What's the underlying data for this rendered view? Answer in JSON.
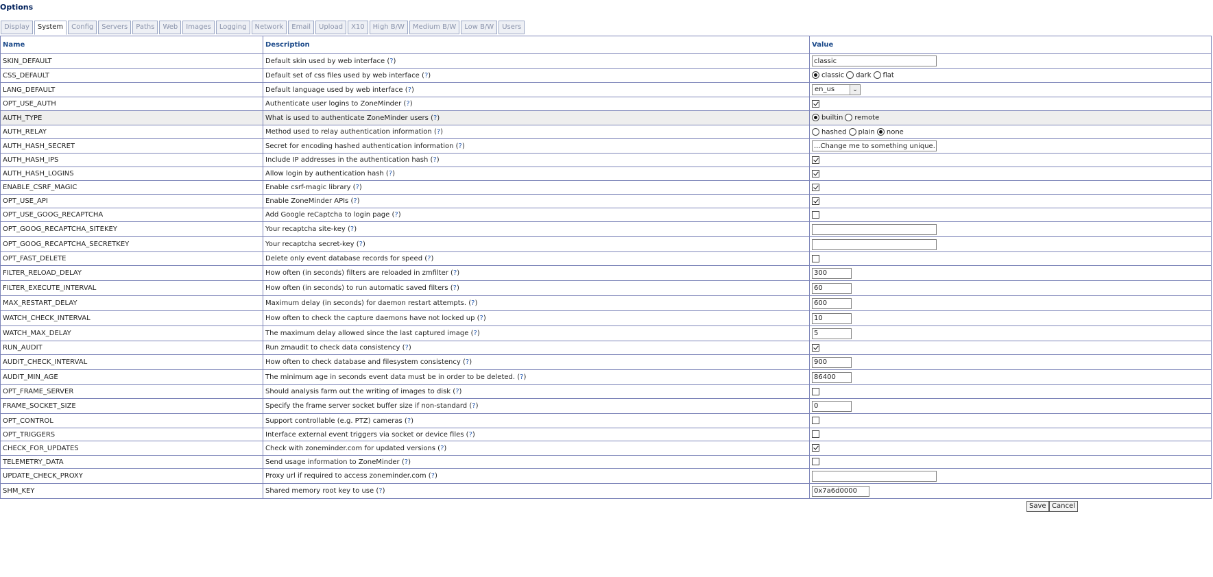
{
  "title": "Options",
  "tabs": [
    "Display",
    "System",
    "Config",
    "Servers",
    "Paths",
    "Web",
    "Images",
    "Logging",
    "Network",
    "Email",
    "Upload",
    "X10",
    "High B/W",
    "Medium B/W",
    "Low B/W",
    "Users"
  ],
  "active_tab": "System",
  "columns": {
    "name": "Name",
    "description": "Description",
    "value": "Value"
  },
  "help_link": "?",
  "rows": [
    {
      "name": "SKIN_DEFAULT",
      "desc": "Default skin used by web interface",
      "type": "text",
      "value": "classic",
      "width": "long"
    },
    {
      "name": "CSS_DEFAULT",
      "desc": "Default set of css files used by web interface",
      "type": "radio",
      "options": [
        "classic",
        "dark",
        "flat"
      ],
      "selected": "classic"
    },
    {
      "name": "LANG_DEFAULT",
      "desc": "Default language used by web interface",
      "type": "select",
      "value": "en_us"
    },
    {
      "name": "OPT_USE_AUTH",
      "desc": "Authenticate user logins to ZoneMinder",
      "type": "checkbox",
      "checked": true
    },
    {
      "name": "AUTH_TYPE",
      "desc": "What is used to authenticate ZoneMinder users",
      "type": "radio",
      "options": [
        "builtin",
        "remote"
      ],
      "selected": "builtin",
      "highlight": true
    },
    {
      "name": "AUTH_RELAY",
      "desc": "Method used to relay authentication information",
      "type": "radio",
      "options": [
        "hashed",
        "plain",
        "none"
      ],
      "selected": "none"
    },
    {
      "name": "AUTH_HASH_SECRET",
      "desc": "Secret for encoding hashed authentication information",
      "type": "text",
      "value": "...Change me to something unique...",
      "width": "long"
    },
    {
      "name": "AUTH_HASH_IPS",
      "desc": "Include IP addresses in the authentication hash",
      "type": "checkbox",
      "checked": true
    },
    {
      "name": "AUTH_HASH_LOGINS",
      "desc": "Allow login by authentication hash",
      "type": "checkbox",
      "checked": true
    },
    {
      "name": "ENABLE_CSRF_MAGIC",
      "desc": "Enable csrf-magic library",
      "type": "checkbox",
      "checked": true
    },
    {
      "name": "OPT_USE_API",
      "desc": "Enable ZoneMinder APIs",
      "type": "checkbox",
      "checked": true
    },
    {
      "name": "OPT_USE_GOOG_RECAPTCHA",
      "desc": "Add Google reCaptcha to login page",
      "type": "checkbox",
      "checked": false
    },
    {
      "name": "OPT_GOOG_RECAPTCHA_SITEKEY",
      "desc": "Your recaptcha site-key",
      "type": "text",
      "value": "",
      "width": "long"
    },
    {
      "name": "OPT_GOOG_RECAPTCHA_SECRETKEY",
      "desc": "Your recaptcha secret-key",
      "type": "text",
      "value": "",
      "width": "long"
    },
    {
      "name": "OPT_FAST_DELETE",
      "desc": "Delete only event database records for speed",
      "type": "checkbox",
      "checked": false
    },
    {
      "name": "FILTER_RELOAD_DELAY",
      "desc": "How often (in seconds) filters are reloaded in zmfilter",
      "type": "text",
      "value": "300",
      "width": "short"
    },
    {
      "name": "FILTER_EXECUTE_INTERVAL",
      "desc": "How often (in seconds) to run automatic saved filters",
      "type": "text",
      "value": "60",
      "width": "short"
    },
    {
      "name": "MAX_RESTART_DELAY",
      "desc": "Maximum delay (in seconds) for daemon restart attempts.",
      "type": "text",
      "value": "600",
      "width": "short"
    },
    {
      "name": "WATCH_CHECK_INTERVAL",
      "desc": "How often to check the capture daemons have not locked up",
      "type": "text",
      "value": "10",
      "width": "short"
    },
    {
      "name": "WATCH_MAX_DELAY",
      "desc": "The maximum delay allowed since the last captured image",
      "type": "text",
      "value": "5",
      "width": "short"
    },
    {
      "name": "RUN_AUDIT",
      "desc": "Run zmaudit to check data consistency",
      "type": "checkbox",
      "checked": true
    },
    {
      "name": "AUDIT_CHECK_INTERVAL",
      "desc": "How often to check database and filesystem consistency",
      "type": "text",
      "value": "900",
      "width": "short"
    },
    {
      "name": "AUDIT_MIN_AGE",
      "desc": "The minimum age in seconds event data must be in order to be deleted.",
      "type": "text",
      "value": "86400",
      "width": "short"
    },
    {
      "name": "OPT_FRAME_SERVER",
      "desc": "Should analysis farm out the writing of images to disk",
      "type": "checkbox",
      "checked": false
    },
    {
      "name": "FRAME_SOCKET_SIZE",
      "desc": "Specify the frame server socket buffer size if non-standard",
      "type": "text",
      "value": "0",
      "width": "short"
    },
    {
      "name": "OPT_CONTROL",
      "desc": "Support controllable (e.g. PTZ) cameras",
      "type": "checkbox",
      "checked": false
    },
    {
      "name": "OPT_TRIGGERS",
      "desc": "Interface external event triggers via socket or device files",
      "type": "checkbox",
      "checked": false
    },
    {
      "name": "CHECK_FOR_UPDATES",
      "desc": "Check with zoneminder.com for updated versions",
      "type": "checkbox",
      "checked": true
    },
    {
      "name": "TELEMETRY_DATA",
      "desc": "Send usage information to ZoneMinder",
      "type": "checkbox",
      "checked": false
    },
    {
      "name": "UPDATE_CHECK_PROXY",
      "desc": "Proxy url if required to access zoneminder.com",
      "type": "text",
      "value": "",
      "width": "long"
    },
    {
      "name": "SHM_KEY",
      "desc": "Shared memory root key to use",
      "type": "text",
      "value": "0x7a6d0000",
      "width": "mid"
    }
  ],
  "buttons": {
    "save": "Save",
    "cancel": "Cancel"
  }
}
